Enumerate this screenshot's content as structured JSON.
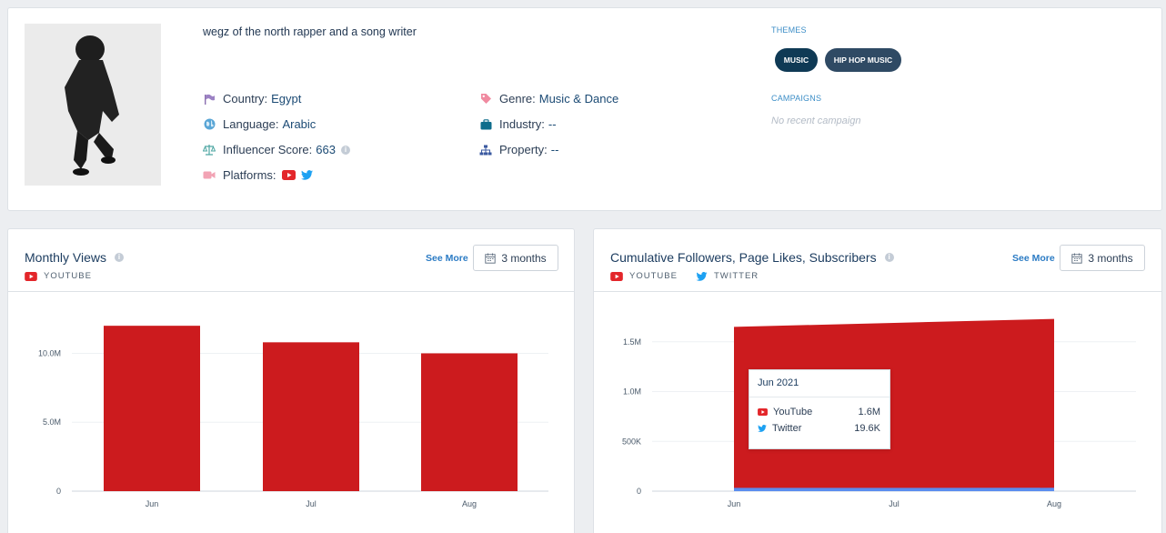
{
  "profile": {
    "bio": "wegz of the north rapper and a song writer",
    "country": {
      "label": "Country:",
      "value": "Egypt"
    },
    "language": {
      "label": "Language:",
      "value": "Arabic"
    },
    "score": {
      "label": "Influencer Score:",
      "value": "663",
      "info": "i"
    },
    "platforms": {
      "label": "Platforms:"
    },
    "genre": {
      "label": "Genre:",
      "value": "Music & Dance"
    },
    "industry": {
      "label": "Industry:",
      "value": "--"
    },
    "property": {
      "label": "Property:",
      "value": "--"
    },
    "themes_title": "THEMES",
    "themes": [
      "MUSIC",
      "HIP HOP MUSIC"
    ],
    "campaigns_title": "CAMPAIGNS",
    "no_campaign": "No recent campaign"
  },
  "colors": {
    "youtube": "#e3262a",
    "twitter": "#1da1f2",
    "bar": "#cc1b1e",
    "navy": "#0f3a55"
  },
  "views": {
    "title": "Monthly Views",
    "info": "i",
    "legend": [
      "YOUTUBE"
    ],
    "see_more": "See More",
    "range": "3 months"
  },
  "followers": {
    "title": "Cumulative Followers, Page Likes, Subscribers",
    "info": "i",
    "legend": [
      "YOUTUBE",
      "TWITTER"
    ],
    "see_more": "See More",
    "range": "3 months",
    "tooltip": {
      "title": "Jun 2021",
      "rows": [
        {
          "name": "YouTube",
          "value": "1.6M"
        },
        {
          "name": "Twitter",
          "value": "19.6K"
        }
      ]
    }
  },
  "chart_data": [
    {
      "type": "bar",
      "title": "Monthly Views",
      "categories": [
        "Jun",
        "Jul",
        "Aug"
      ],
      "series": [
        {
          "name": "YOUTUBE",
          "values": [
            12000000,
            10800000,
            10000000
          ]
        }
      ],
      "yticks": [
        "0",
        "5.0M",
        "10.0M"
      ],
      "ylim": [
        0,
        13000000
      ],
      "grid": true
    },
    {
      "type": "area",
      "title": "Cumulative Followers, Page Likes, Subscribers",
      "categories": [
        "Jun",
        "Jul",
        "Aug"
      ],
      "series": [
        {
          "name": "YOUTUBE",
          "values": [
            1650000,
            1690000,
            1730000
          ]
        },
        {
          "name": "TWITTER",
          "values": [
            19600,
            19800,
            20000
          ]
        }
      ],
      "yticks": [
        "0",
        "500K",
        "1.0M",
        "1.5M"
      ],
      "ylim": [
        0,
        1900000
      ],
      "grid": true
    }
  ]
}
